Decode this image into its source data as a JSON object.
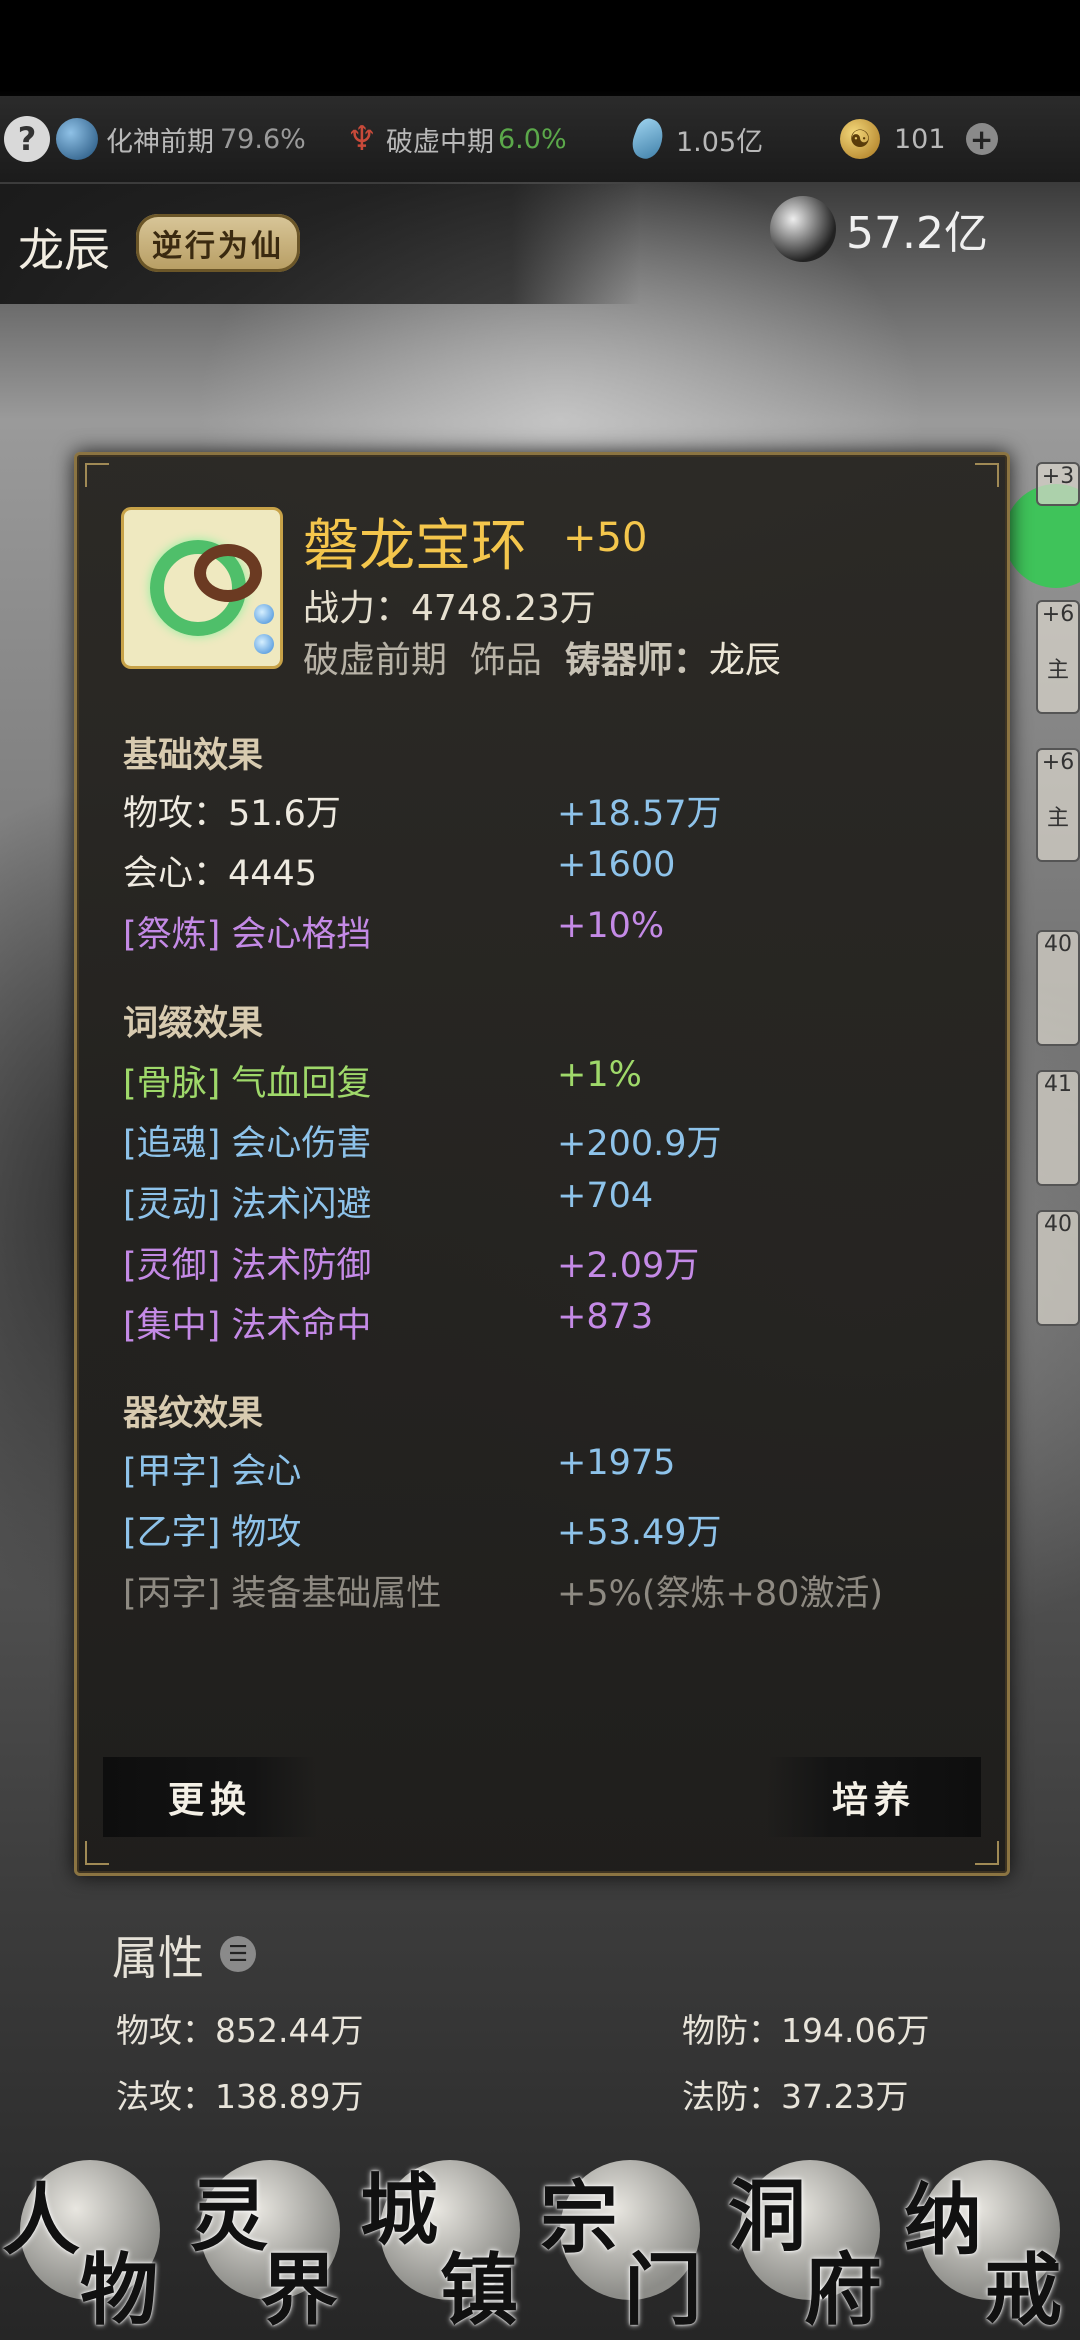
{
  "topbar": {
    "help": "?",
    "realm1": "化神前期",
    "realm1_pct": "79.6%",
    "realm2": "破虚中期",
    "realm2_pct": "6.0%",
    "stones": "1.05亿",
    "currency": "101",
    "plus": "+"
  },
  "player": {
    "name": "龙辰",
    "title": "逆行为仙",
    "power": "57.2亿"
  },
  "edge_labels": [
    "+3",
    "+6",
    "主",
    "+6",
    "主",
    "40",
    "41",
    "40"
  ],
  "item": {
    "name": "磐龙宝环",
    "level": "+50",
    "power_label": "战力：",
    "power": "4748.23万",
    "realm": "破虚前期",
    "type": "饰品",
    "maker_label": "铸器师：",
    "maker": "龙辰"
  },
  "sections": {
    "basic": "基础效果",
    "affix": "词缀效果",
    "pattern": "器纹效果"
  },
  "basic_rows": [
    {
      "label": "物攻：51.6万",
      "value": "+18.57万"
    },
    {
      "label": "会心：4445",
      "value": "+1600"
    },
    {
      "label": "[祭炼] 会心格挡",
      "value": "+10%"
    }
  ],
  "affix_rows": [
    {
      "label": "[骨脉] 气血回复",
      "value": "+1%"
    },
    {
      "label": "[追魂] 会心伤害",
      "value": "+200.9万"
    },
    {
      "label": "[灵动] 法术闪避",
      "value": "+704"
    },
    {
      "label": "[灵御] 法术防御",
      "value": "+2.09万"
    },
    {
      "label": "[集中] 法术命中",
      "value": "+873"
    }
  ],
  "pattern_rows": [
    {
      "label": "[甲字] 会心",
      "value": "+1975"
    },
    {
      "label": "[乙字] 物攻",
      "value": "+53.49万"
    },
    {
      "label": "[丙字] 装备基础属性",
      "value": "+5%(祭炼+80激活)"
    }
  ],
  "buttons": {
    "replace": "更换",
    "train": "培养"
  },
  "attributes": {
    "title": "属性",
    "phys_atk": "物攻：852.44万",
    "phys_def": "物防：194.06万",
    "mag_atk": "法攻：138.89万",
    "mag_def": "法防：37.23万"
  },
  "nav": [
    {
      "c1": "人",
      "c2": "物"
    },
    {
      "c1": "灵",
      "c2": "界"
    },
    {
      "c1": "城",
      "c2": "镇"
    },
    {
      "c1": "宗",
      "c2": "门"
    },
    {
      "c1": "洞",
      "c2": "府"
    },
    {
      "c1": "纳",
      "c2": "戒"
    }
  ],
  "colors": {
    "item_name": "#f4c64c",
    "blue_text": "#8ec3ea",
    "purple_text": "#c48ae6",
    "green_text": "#9fd96a",
    "frame": "#8b7442"
  }
}
